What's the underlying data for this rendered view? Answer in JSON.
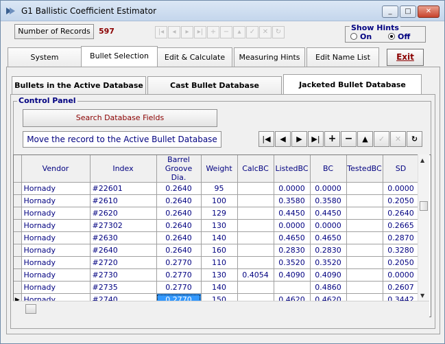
{
  "window": {
    "title": "G1 Ballistic Coefficient Estimator",
    "minimize": "_",
    "maximize": "□",
    "close": "✕"
  },
  "records": {
    "label": "Number of Records",
    "count": "597"
  },
  "hints": {
    "caption": "Show Hints",
    "on": "On",
    "off": "Off",
    "selected": "Off"
  },
  "main_tabs": [
    {
      "label": "System"
    },
    {
      "label": "Bullet Selection"
    },
    {
      "label": "Edit & Calculate B.C."
    },
    {
      "label": "Measuring Hints"
    },
    {
      "label": "Edit Name List"
    }
  ],
  "exit_label": "Exit",
  "db_tabs": [
    {
      "label": "Bullets in the Active Database"
    },
    {
      "label": "Cast Bullet Database"
    },
    {
      "label": "Jacketed Bullet Database"
    }
  ],
  "control_panel": {
    "caption": "Control Panel",
    "search_label": "Search Database Fields",
    "move_label": "Move the record to the Active Bullet Database"
  },
  "nav_icons": [
    "first-icon",
    "prev-icon",
    "next-icon",
    "last-icon",
    "add-icon",
    "delete-icon",
    "edit-icon",
    "post-icon",
    "cancel-icon",
    "refresh-icon"
  ],
  "table": {
    "columns": [
      "Vendor",
      "Index",
      "Barrel Groove Dia.",
      "Weight",
      "CalcBC",
      "ListedBC",
      "BC",
      "TestedBC",
      "SD"
    ],
    "rows": [
      [
        "Hornady",
        "#22601",
        "0.2640",
        "95",
        "",
        "0.0000",
        "0.0000",
        "",
        "0.0000"
      ],
      [
        "Hornady",
        "#2610",
        "0.2640",
        "100",
        "",
        "0.3580",
        "0.3580",
        "",
        "0.2050"
      ],
      [
        "Hornady",
        "#2620",
        "0.2640",
        "129",
        "",
        "0.4450",
        "0.4450",
        "",
        "0.2640"
      ],
      [
        "Hornady",
        "#27302",
        "0.2640",
        "130",
        "",
        "0.0000",
        "0.0000",
        "",
        "0.2665"
      ],
      [
        "Hornady",
        "#2630",
        "0.2640",
        "140",
        "",
        "0.4650",
        "0.4650",
        "",
        "0.2870"
      ],
      [
        "Hornady",
        "#2640",
        "0.2640",
        "160",
        "",
        "0.2830",
        "0.2830",
        "",
        "0.3280"
      ],
      [
        "Hornady",
        "#2720",
        "0.2770",
        "110",
        "",
        "0.3520",
        "0.3520",
        "",
        "0.2050"
      ],
      [
        "Hornady",
        "#2730",
        "0.2770",
        "130",
        "0.4054",
        "0.4090",
        "0.4090",
        "",
        "0.0000"
      ],
      [
        "Hornady",
        "#2735",
        "0.2770",
        "140",
        "",
        "",
        "0.4860",
        "",
        "0.2607"
      ],
      [
        "Hornady",
        "#2740",
        "0.2770",
        "150",
        "",
        "0.4620",
        "0.4620",
        "",
        "0.3442"
      ]
    ],
    "current_row_marker": "▶"
  }
}
